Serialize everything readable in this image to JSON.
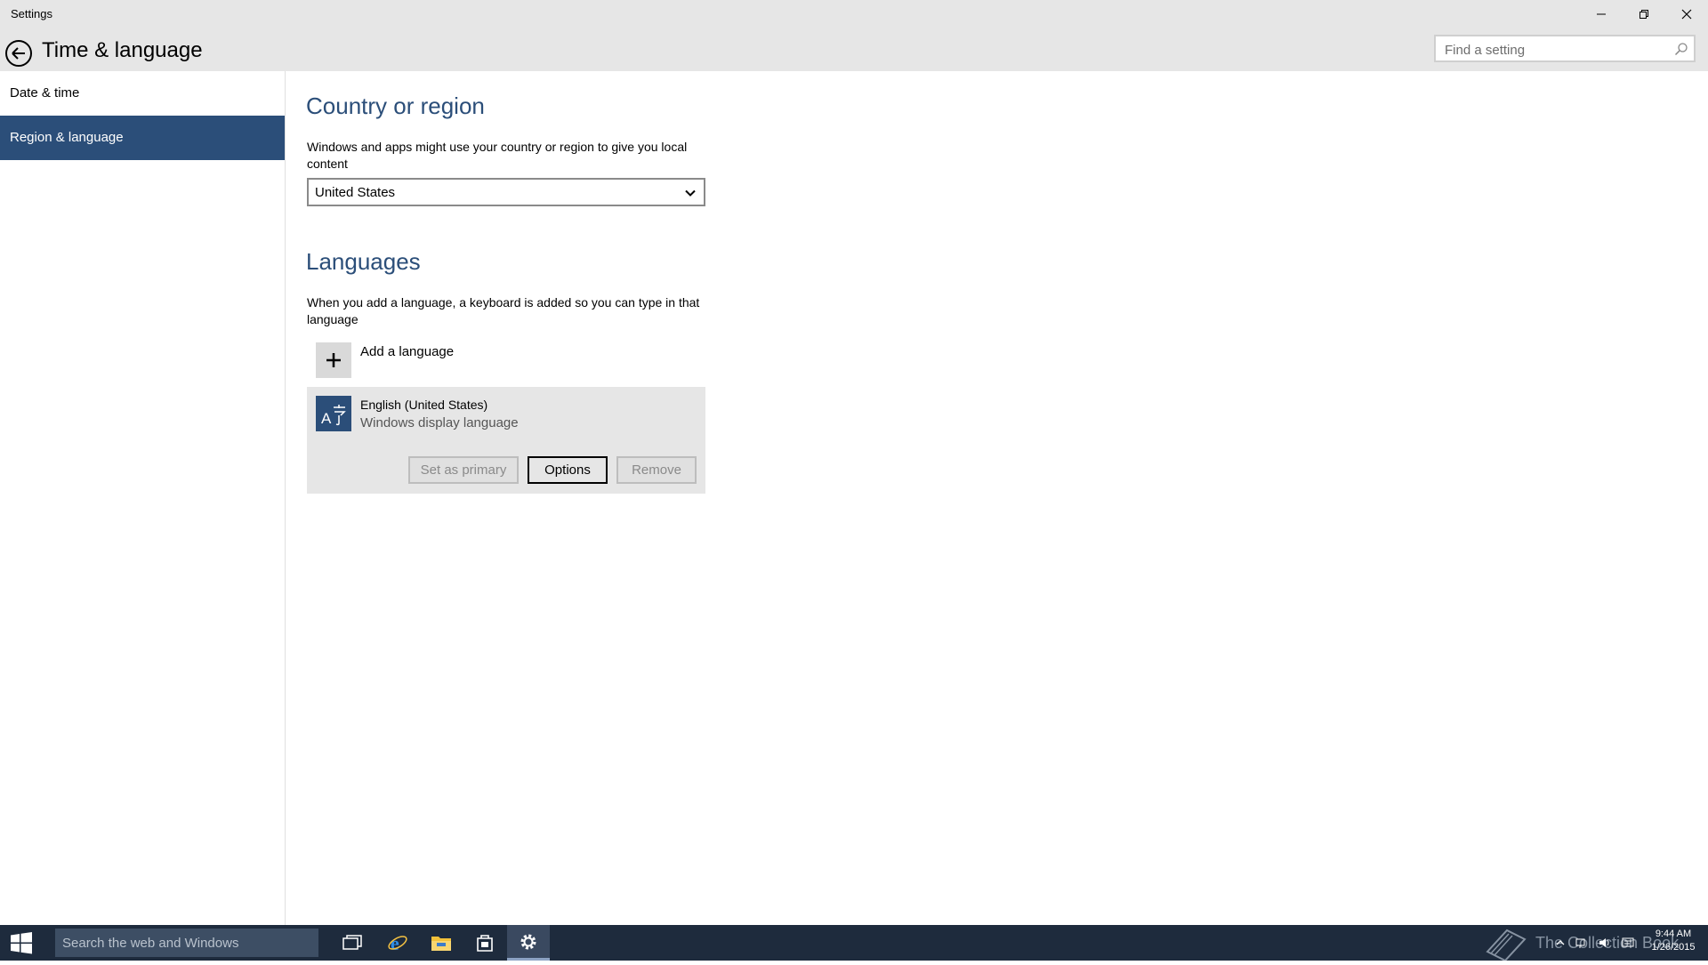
{
  "window": {
    "title": "Settings",
    "minimize_icon": "minimize-icon",
    "maximize_icon": "restore-icon",
    "close_icon": "close-icon"
  },
  "header": {
    "back_icon": "back-arrow-icon",
    "title": "Time & language",
    "search_placeholder": "Find a setting",
    "search_icon": "search-icon"
  },
  "sidebar": {
    "items": [
      {
        "label": "Date & time",
        "selected": false
      },
      {
        "label": "Region & language",
        "selected": true
      }
    ]
  },
  "country": {
    "title": "Country or region",
    "description": "Windows and apps might use your country or region to give you local content",
    "selected_value": "United States"
  },
  "languages": {
    "title": "Languages",
    "description": "When you add a language, a keyboard is added so you can type in that language",
    "add_label": "Add a language",
    "items": [
      {
        "name": "English (United States)",
        "subtitle": "Windows display language"
      }
    ],
    "buttons": {
      "set_primary": "Set as primary",
      "options": "Options",
      "remove": "Remove"
    }
  },
  "taskbar": {
    "search_placeholder": "Search the web and Windows",
    "apps": [
      "task-view-icon",
      "internet-explorer-icon",
      "file-explorer-icon",
      "store-icon",
      "settings-icon"
    ],
    "watermark": "The Collection Book",
    "clock_time": "9:44 AM",
    "clock_date": "1/26/2015"
  },
  "colors": {
    "accent": "#2b4e79",
    "titlebar": "#e6e6e6",
    "taskbar": "#1e2b3d"
  }
}
